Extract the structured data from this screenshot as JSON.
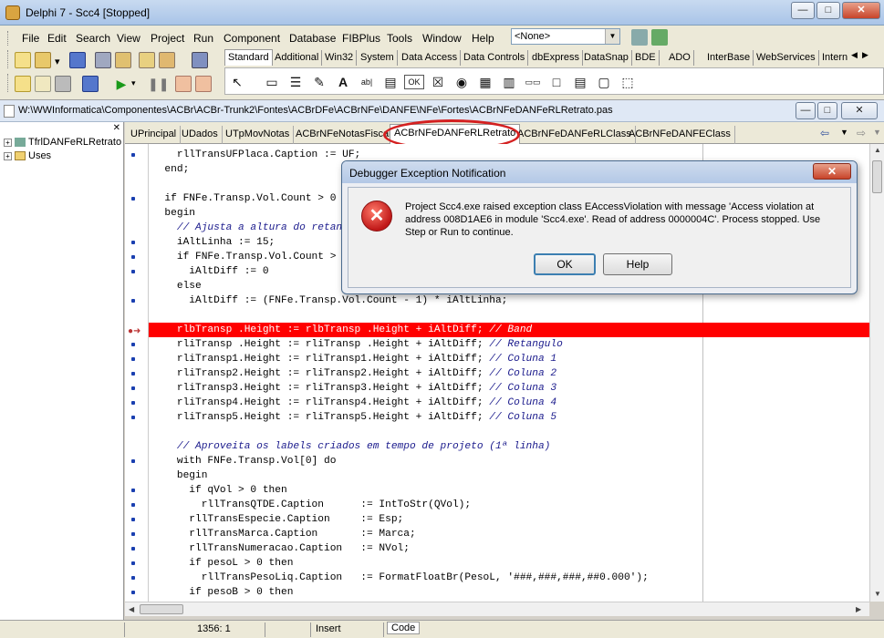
{
  "window": {
    "title": "Delphi 7 - Scc4 [Stopped]",
    "controls": [
      "—",
      "□",
      "✕"
    ]
  },
  "menu": [
    "File",
    "Edit",
    "Search",
    "View",
    "Project",
    "Run",
    "Component",
    "Database",
    "FIBPlus",
    "Tools",
    "Window",
    "Help"
  ],
  "desktop_combo": "<None>",
  "palette_tabs": [
    "Standard",
    "Additional",
    "Win32",
    "System",
    "Data Access",
    "Data Controls",
    "dbExpress",
    "DataSnap",
    "BDE",
    "ADO",
    "InterBase",
    "WebServices",
    "Intern"
  ],
  "palette_icons": [
    "↖",
    "▭",
    "☰",
    "✎",
    "A",
    "ab|",
    "▤",
    "OK",
    "☒",
    "◉",
    "▦",
    "▥",
    "▭▭",
    "□",
    "▤",
    "▢",
    "⬚"
  ],
  "editor": {
    "path": "W:\\WWInformatica\\Componentes\\ACBr\\ACBr-Trunk2\\Fontes\\ACBrDFe\\ACBrNFe\\DANFE\\NFe\\Fortes\\ACBrNFeDANFeRLRetrato.pas",
    "tabs": [
      "UPrincipal",
      "UDados",
      "UTpMovNotas",
      "ACBrNFeNotasFiscais",
      "ACBrNFeDANFeRLRetrato",
      "ACBrNFeDANFeRLClass",
      "ACBrNFeDANFEClass"
    ],
    "active_tab": "ACBrNFeDANFeRLRetrato"
  },
  "explorer": {
    "items": [
      "TfrlDANFeRLRetrato",
      "Uses"
    ]
  },
  "code_lines": [
    "    rllTransUFPlaca.Caption := UF;",
    "  end;",
    "",
    "  if FNFe.Transp.Vol.Count > 0 then",
    "  begin",
    "    // Ajusta a altura do retangulo",
    "    iAltLinha := 15;",
    "    if FNFe.Transp.Vol.Count > 1 then",
    "      iAltDiff := 0",
    "    else",
    "      iAltDiff := (FNFe.Transp.Vol.Count - 1) * iAltLinha;",
    "",
    "    rlbTransp .Height := rlbTransp .Height + iAltDiff; // Band",
    "    rliTransp .Height := rliTransp .Height + iAltDiff; // Retangulo",
    "    rliTransp1.Height := rliTransp1.Height + iAltDiff; // Coluna 1",
    "    rliTransp2.Height := rliTransp2.Height + iAltDiff; // Coluna 2",
    "    rliTransp3.Height := rliTransp3.Height + iAltDiff; // Coluna 3",
    "    rliTransp4.Height := rliTransp4.Height + iAltDiff; // Coluna 4",
    "    rliTransp5.Height := rliTransp5.Height + iAltDiff; // Coluna 5",
    "",
    "    // Aproveita os labels criados em tempo de projeto (1ª linha)",
    "    with FNFe.Transp.Vol[0] do",
    "    begin",
    "      if qVol > 0 then",
    "        rllTransQTDE.Caption      := IntToStr(QVol);",
    "      rllTransEspecie.Caption     := Esp;",
    "      rllTransMarca.Caption       := Marca;",
    "      rllTransNumeracao.Caption   := NVol;",
    "      if pesoL > 0 then",
    "        rllTransPesoLiq.Caption   := FormatFloatBr(PesoL, '###,###,###,##0.000');",
    "      if pesoB > 0 then"
  ],
  "highlight_line": 12,
  "status": {
    "position": "1356:  1",
    "mode": "Insert",
    "tab": "Code"
  },
  "dialog": {
    "title": "Debugger Exception Notification",
    "close": "✕",
    "message": "Project Scc4.exe raised exception class EAccessViolation with message 'Access violation at address 008D1AE6 in module 'Scc4.exe'. Read of address 0000004C'. Process stopped. Use Step or Run to continue.",
    "ok_label": "OK",
    "help_label": "Help"
  },
  "colors": {
    "highlight": "#ff0000",
    "annotation_circle": "#d42020"
  }
}
